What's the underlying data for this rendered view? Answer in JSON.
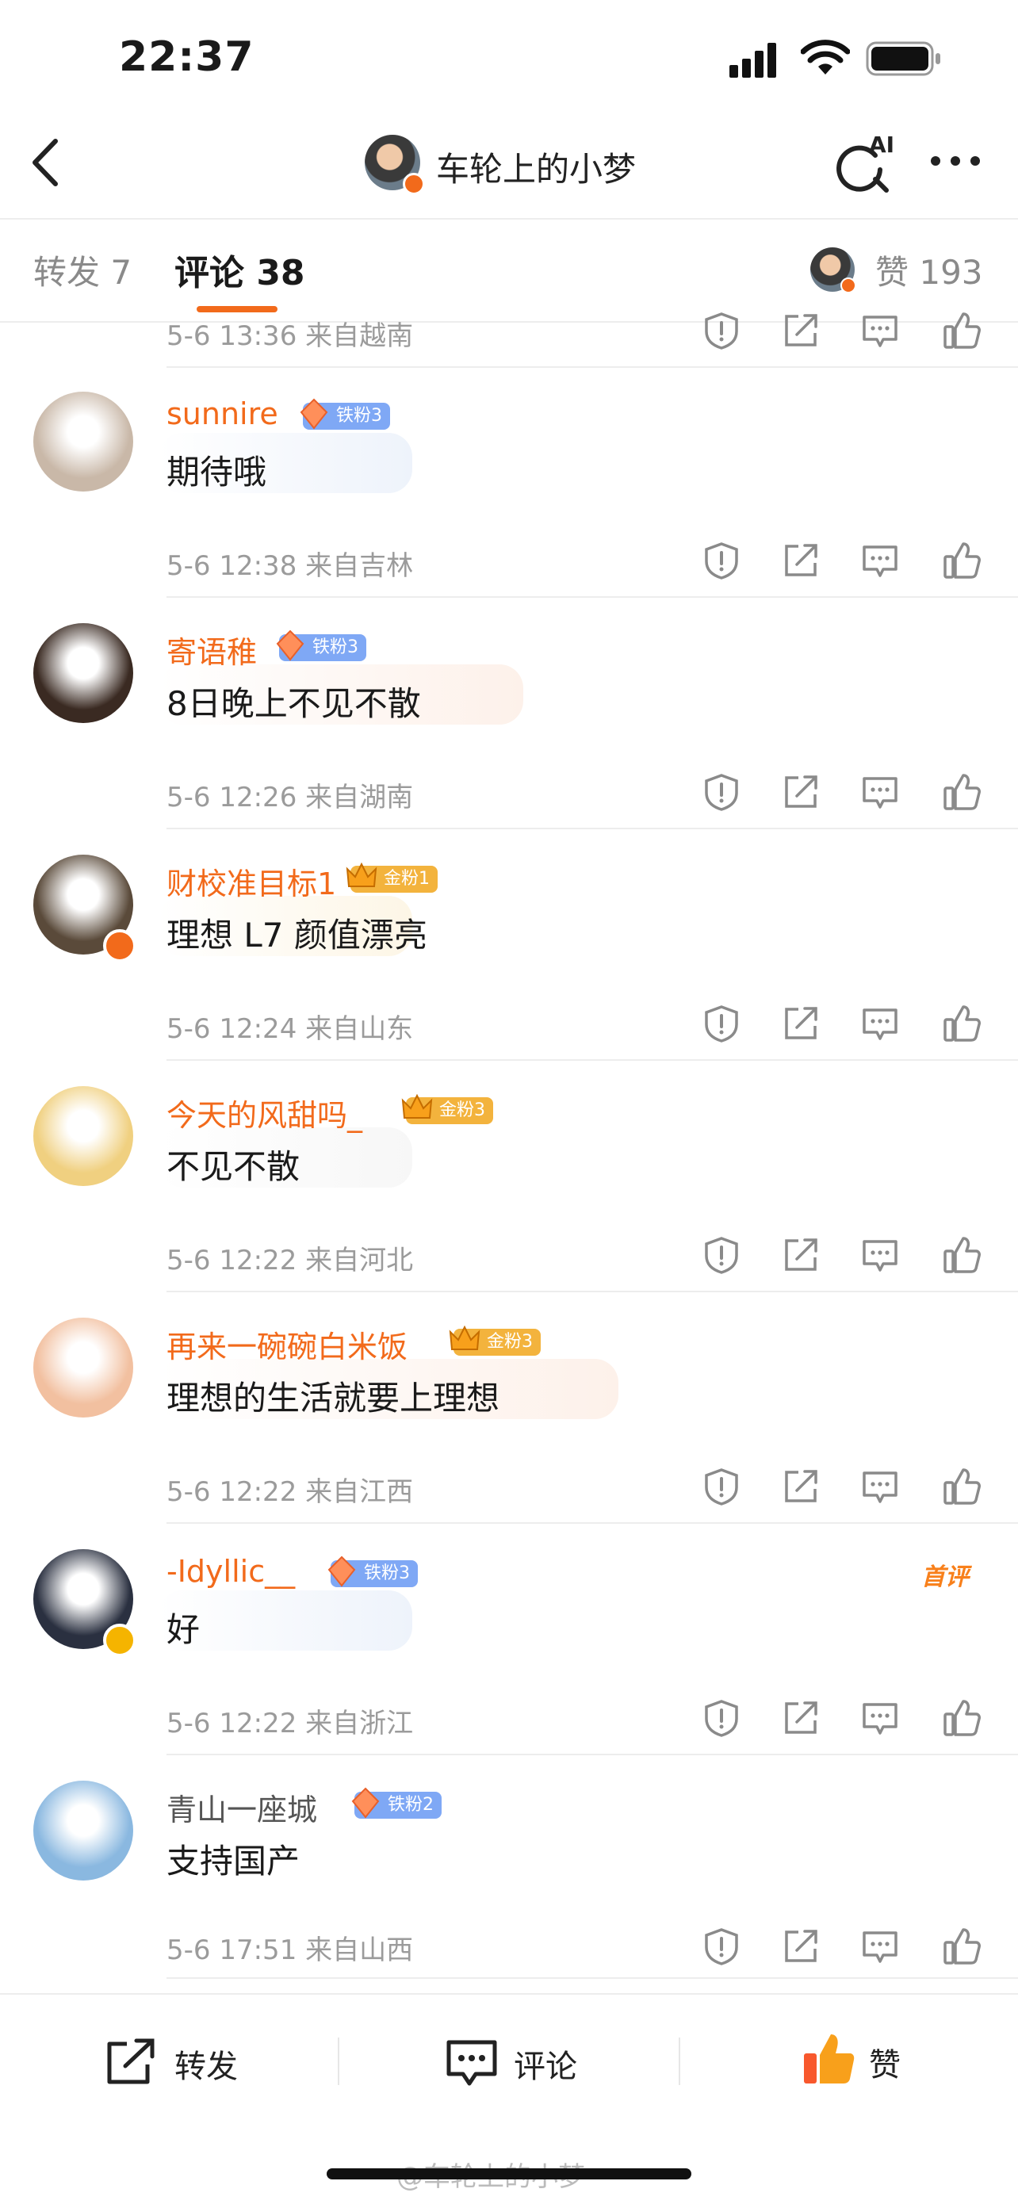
{
  "status_bar": {
    "time": "22:37"
  },
  "nav": {
    "title": "车轮上的小梦",
    "ai_label": "AI"
  },
  "tabs": {
    "repost": "转发 7",
    "comment": "评论 38",
    "likes": "赞 193"
  },
  "partial_row": {
    "meta": "5-6 13:36 来自越南"
  },
  "comments": [
    {
      "name": "sunnire",
      "badge": "铁粉3",
      "badge_type": "iron",
      "text": "期待哦",
      "meta": "5-6 12:38 来自吉林",
      "avatar_color": "#c9b8a8"
    },
    {
      "name": "寄语稚",
      "badge": "铁粉3",
      "badge_type": "iron",
      "text": "8日晚上不见不散",
      "meta": "5-6 12:26 来自湖南",
      "avatar_color": "#3a2a22"
    },
    {
      "name": "财校准目标1",
      "badge": "金粉1",
      "badge_type": "gold",
      "text": "理想 L7 颜值漂亮",
      "meta": "5-6 12:24 来自山东",
      "avatar_color": "#5a4a3a"
    },
    {
      "name": "今天的风甜吗_",
      "badge": "金粉3",
      "badge_type": "gold",
      "text": "不见不散",
      "meta": "5-6 12:22 来自河北",
      "avatar_color": "#f0d080"
    },
    {
      "name": "再来一碗碗白米饭",
      "badge": "金粉3",
      "badge_type": "gold",
      "text": "理想的生活就要上理想",
      "meta": "5-6 12:22 来自江西",
      "avatar_color": "#f2c0a0"
    },
    {
      "name": "-Idyllic__",
      "badge": "铁粉3",
      "badge_type": "iron",
      "text": "好",
      "meta": "5-6 12:22 来自浙江",
      "avatar_color": "#2a3040",
      "tag": "首评"
    },
    {
      "name": "青山一座城",
      "badge": "铁粉2",
      "badge_type": "iron",
      "text": "支持国产",
      "meta": "5-6 17:51 来自山西",
      "avatar_color": "#8ab8e0"
    }
  ],
  "bottom_bar": {
    "repost": "转发",
    "comment": "评论",
    "like": "赞"
  },
  "watermark": "@车轮上的小梦",
  "colors": {
    "accent": "#f26a1b",
    "muted": "#9b9b9b",
    "divider": "#ededed"
  }
}
